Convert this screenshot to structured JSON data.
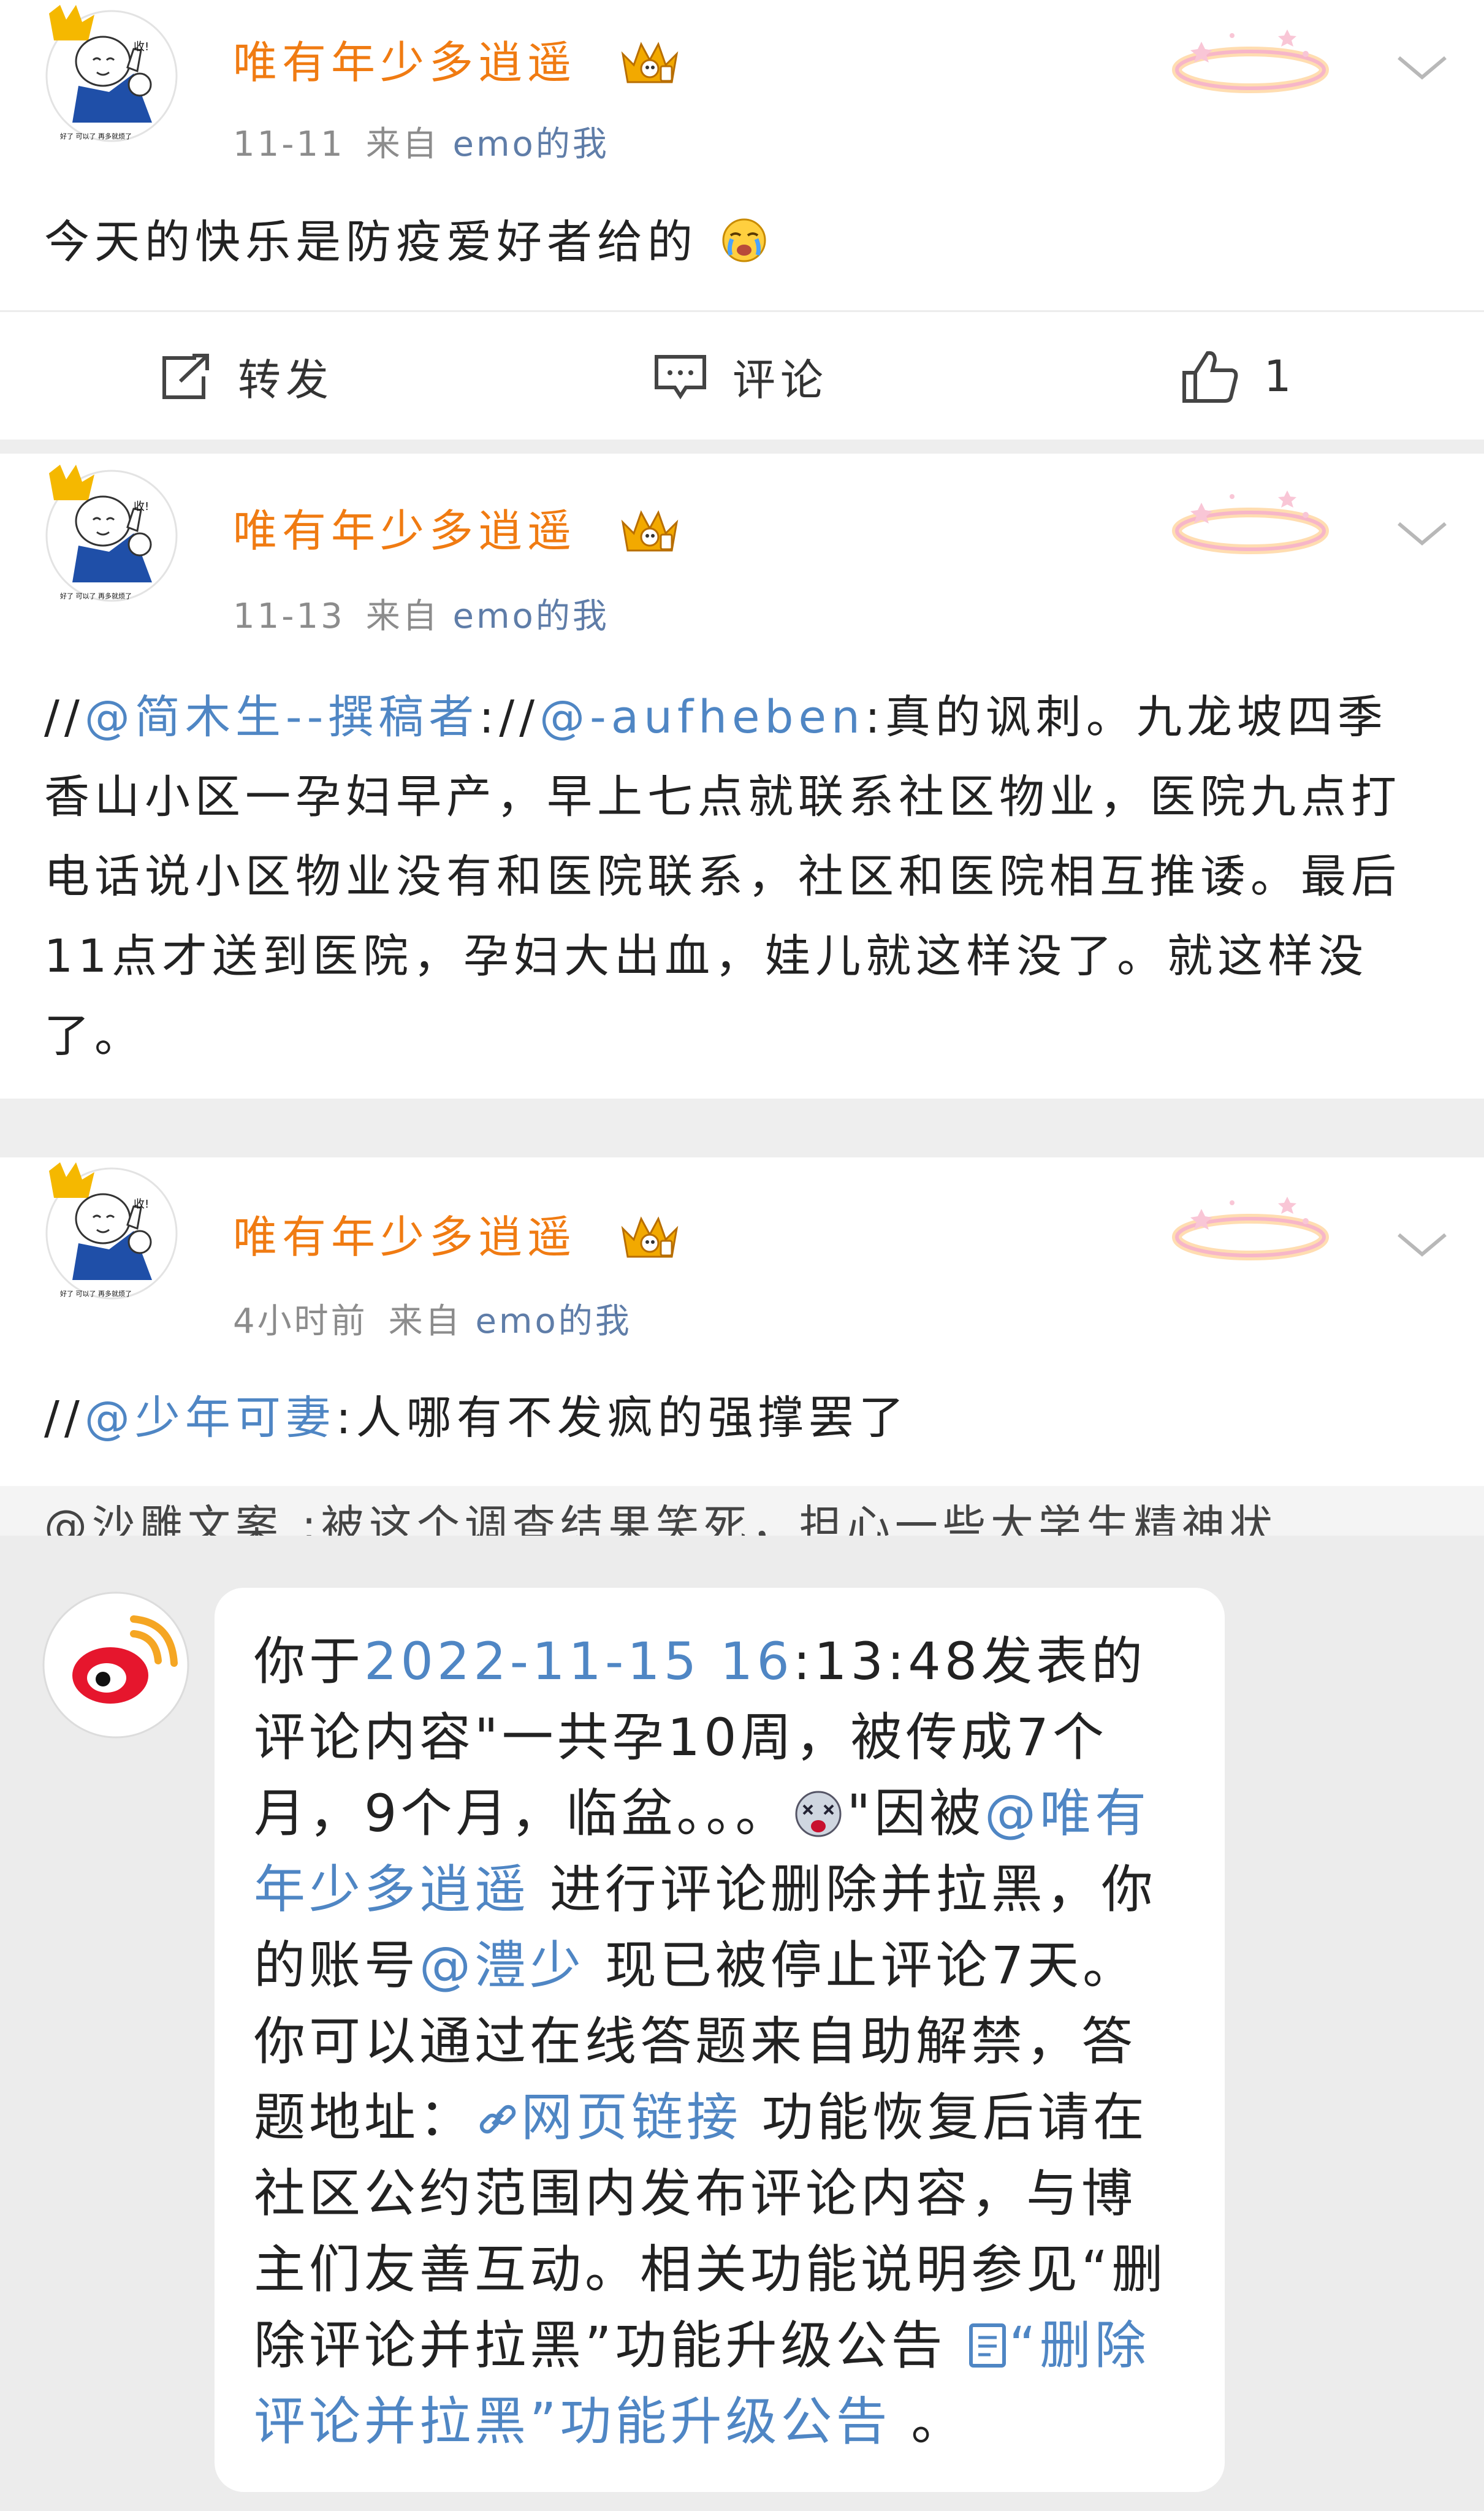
{
  "posts": [
    {
      "user_name": "唯有年少多逍遥",
      "date": "11-11",
      "source_prefix": "来自",
      "source_app": "emo的我",
      "content": "今天的快乐是防疫爱好者给的",
      "content_emoji": "crying-emoji",
      "actions": {
        "repost": "转发",
        "comment": "评论",
        "like_count": "1"
      },
      "avatar_caption": "好了 可以了 再多就烦了",
      "avatar_badge_text": "收!"
    },
    {
      "user_name": "唯有年少多逍遥",
      "date": "11-13",
      "source_prefix": "来自",
      "source_app": "emo的我",
      "content_parts": {
        "slashes1": "//",
        "mention1": "@简木生--撰稿者",
        "sep1": ":",
        "slashes2": "//",
        "mention2": "@-aufheben",
        "text": ":真的讽刺。九龙坡四季香山小区一孕妇早产，早上七点就联系社区物业，医院九点打电话说小区物业没有和医院联系，社区和医院相互推诿。最后11点才送到医院，孕妇大出血，娃儿就这样没了。就这样没了。"
      },
      "avatar_caption": "好了 可以了 再多就烦了",
      "avatar_badge_text": "收!"
    },
    {
      "user_name": "唯有年少多逍遥",
      "date": "4小时前",
      "source_prefix": "来自",
      "source_app": "emo的我",
      "content_parts": {
        "slashes": "//",
        "mention": "@少年可妻",
        "text": ":人哪有不发疯的强撑罢了"
      },
      "quoted_partial": "@沙雕文案 :被这个调查结果笑死，担心一些大学生精神状",
      "avatar_caption": "好了 可以了 再多就烦了",
      "avatar_badge_text": "收!"
    }
  ],
  "notification": {
    "sender_icon": "weibo-logo-icon",
    "p1": "你于",
    "date_link": "2022-11-15 16",
    "p2": ":13:48发表的评论内容\"一共孕10周，被传成7个月，9个月，临盆。。。",
    "emoji": "dizzy-face-emoji",
    "p3": "\"因被",
    "mention_blogger": "@唯有年少多逍遥",
    "p4": " 进行评论删除并拉黑，你的账号",
    "mention_user": "@澧少",
    "p5": " 现已被停止评论7天。你可以通过在线答题来自助解禁，答题地址：",
    "link_icon": "link-icon",
    "web_link": "网页链接",
    "p6": " 功能恢复后请在社区公约范围内发布评论内容，与博主们友善互动。相关功能说明参见“删除评论并拉黑”功能升级公告 ",
    "doc_icon": "document-icon",
    "doc_link": "“删除评论并拉黑”功能升级公告",
    "p7": " 。"
  },
  "colors": {
    "username": "#f07b12",
    "link": "#4f86c4",
    "meta_gray": "#8c8c8c",
    "page_bg": "#eeeeee",
    "weibo_red": "#e6162d"
  }
}
